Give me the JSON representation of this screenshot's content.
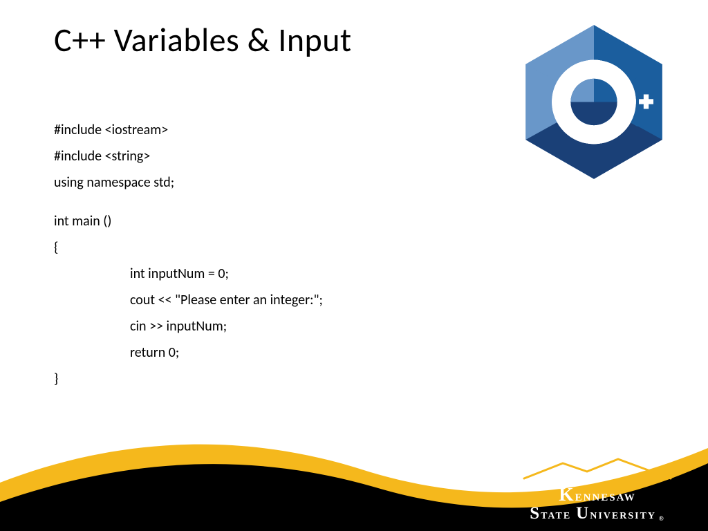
{
  "title": "C++ Variables & Input",
  "code": {
    "l0": "#include <iostream>",
    "l1": "#include <string>",
    "l2": "using namespace std;",
    "l3": "int main ()",
    "l4": "{",
    "l5": "int inputNum = 0;",
    "l6": "cout << \"Please enter an integer:\";",
    "l7": "cin >> inputNum;",
    "l8": "return 0;",
    "l9": "}"
  },
  "logo": {
    "cpp_letter": "C",
    "cpp_plus": "++",
    "university_line1": "Kennesaw",
    "university_line2": "State University"
  },
  "colors": {
    "gold": "#f5b81c",
    "black": "#000000",
    "hex_light": "#6997c9",
    "hex_mid": "#1b5e9e",
    "hex_dark": "#1a4077"
  }
}
